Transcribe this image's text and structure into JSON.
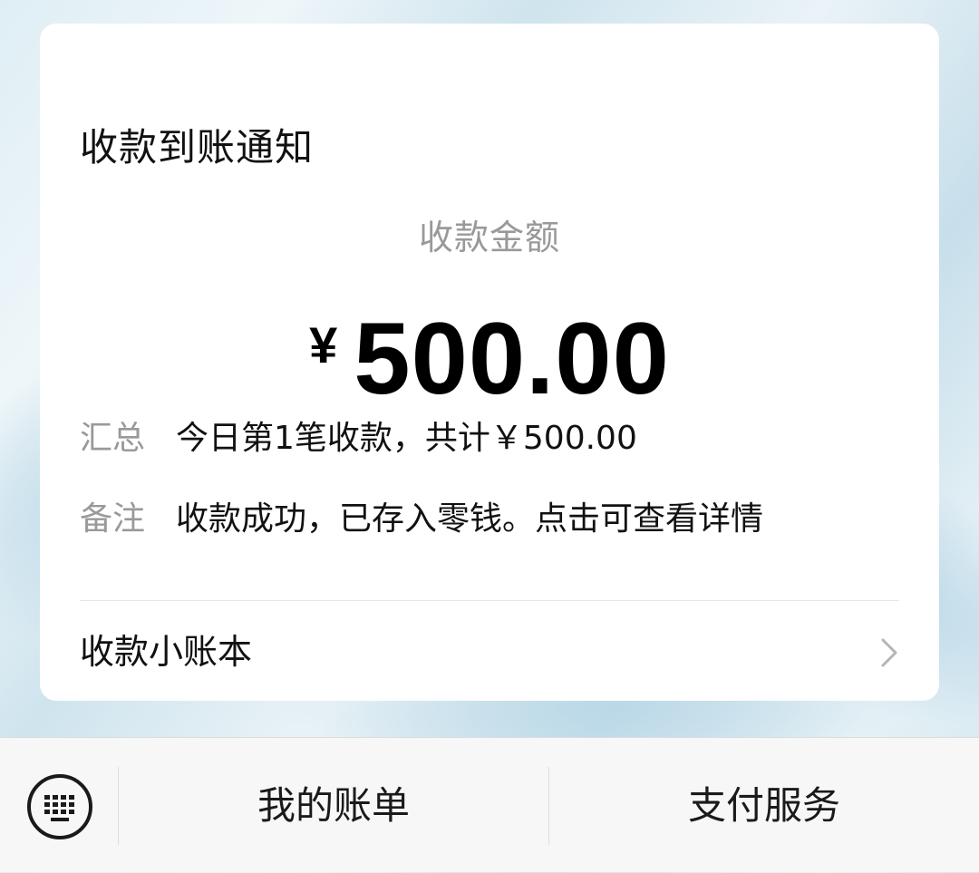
{
  "card": {
    "title": "收款到账通知",
    "amount_label": "收款金额",
    "currency_symbol": "¥",
    "amount": "500.00",
    "summary": {
      "key": "汇总",
      "value": "今日第1笔收款，共计￥500.00"
    },
    "remark": {
      "key": "备注",
      "value": "收款成功，已存入零钱。点击可查看详情"
    },
    "ledger_link": "收款小账本",
    "ledger_icon": "chevron-right-icon"
  },
  "bottom_bar": {
    "keyboard_icon": "keyboard-icon",
    "menu": [
      {
        "label": "我的账单"
      },
      {
        "label": "支付服务"
      }
    ]
  },
  "colors": {
    "card_background": "#ffffff",
    "primary_text": "#111111",
    "secondary_text": "#999999",
    "bottom_bar_background": "#f7f7f7"
  }
}
